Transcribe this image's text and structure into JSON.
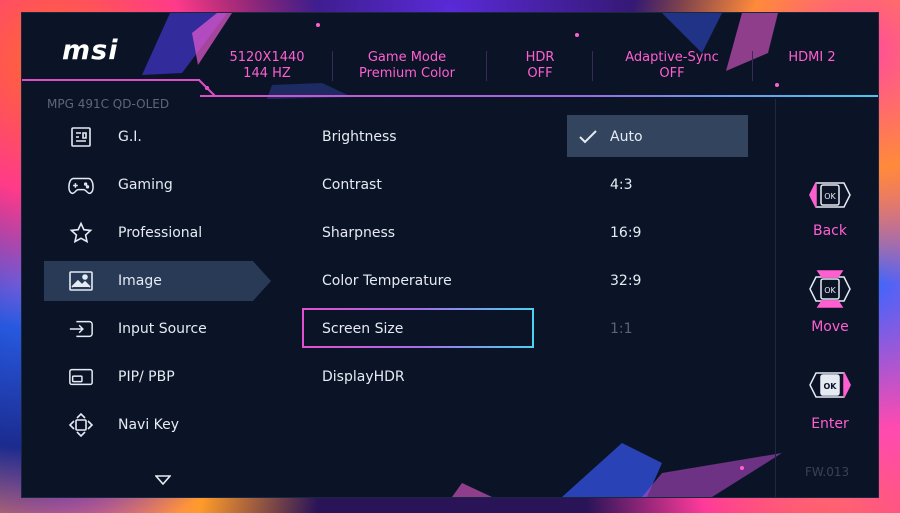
{
  "brand": {
    "logo_text": "msi"
  },
  "status_bar": [
    {
      "line1": "5120X1440",
      "line2": "144 HZ"
    },
    {
      "line1": "Game Mode",
      "line2": "Premium Color"
    },
    {
      "line1": "HDR",
      "line2": "OFF"
    },
    {
      "line1": "Adaptive-Sync",
      "line2": "OFF"
    },
    {
      "line1": "HDMI 2",
      "line2": ""
    }
  ],
  "model_name": "MPG 491C QD-OLED",
  "sidebar": {
    "items": [
      {
        "label": "G.I.",
        "icon": "gi-chip-icon"
      },
      {
        "label": "Gaming",
        "icon": "gamepad-icon"
      },
      {
        "label": "Professional",
        "icon": "star-icon"
      },
      {
        "label": "Image",
        "icon": "image-icon",
        "active": true
      },
      {
        "label": "Input Source",
        "icon": "input-source-icon"
      },
      {
        "label": "PIP/ PBP",
        "icon": "pip-icon"
      },
      {
        "label": "Navi Key",
        "icon": "navi-key-icon"
      }
    ],
    "more_icon": "chevron-down-icon"
  },
  "options": {
    "items": [
      "Brightness",
      "Contrast",
      "Sharpness",
      "Color Temperature",
      "Screen Size",
      "DisplayHDR"
    ],
    "selected": "Screen Size"
  },
  "values": {
    "items": [
      "Auto",
      "4:3",
      "16:9",
      "32:9",
      "1:1"
    ],
    "checked": "Auto",
    "disabled": [
      "1:1"
    ]
  },
  "nav_keys": [
    {
      "label": "Back",
      "icon": "joystick-back-icon"
    },
    {
      "label": "Move",
      "icon": "joystick-move-icon"
    },
    {
      "label": "Enter",
      "icon": "joystick-enter-icon"
    }
  ],
  "firmware": "FW.013",
  "colors": {
    "accent_pink": "#ff5fd0",
    "accent_cyan": "#45c9f0",
    "panel_bg": "#0b1427",
    "highlight": "#283a56"
  }
}
